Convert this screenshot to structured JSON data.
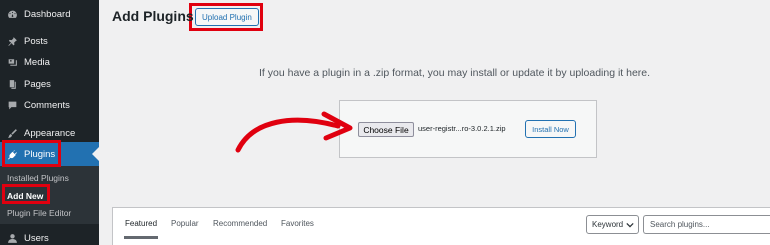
{
  "sidebar": {
    "items": [
      {
        "label": "Dashboard",
        "icon": "dashboard-icon"
      },
      {
        "label": "Posts",
        "icon": "pushpin-icon"
      },
      {
        "label": "Media",
        "icon": "media-icon"
      },
      {
        "label": "Pages",
        "icon": "pages-icon"
      },
      {
        "label": "Comments",
        "icon": "comment-icon"
      },
      {
        "label": "Appearance",
        "icon": "brush-icon"
      },
      {
        "label": "Plugins",
        "icon": "plug-icon"
      },
      {
        "label": "Users",
        "icon": "user-icon"
      }
    ],
    "submenu": {
      "installed": "Installed Plugins",
      "add_new": "Add New",
      "file_editor": "Plugin File Editor"
    }
  },
  "header": {
    "title": "Add Plugins",
    "upload_button": "Upload Plugin"
  },
  "upload": {
    "description": "If you have a plugin in a .zip format, you may install or update it by uploading it here.",
    "choose_file_label": "Choose File",
    "file_name": "user-registr...ro-3.0.2.1.zip",
    "install_button": "Install Now"
  },
  "filter": {
    "tabs": [
      "Featured",
      "Popular",
      "Recommended",
      "Favorites"
    ],
    "active_tab": "Featured",
    "search_type": "Keyword",
    "search_placeholder": "Search plugins..."
  },
  "colors": {
    "sidebar_bg": "#1d2327",
    "accent": "#2271b1",
    "highlight": "#e0000f"
  }
}
